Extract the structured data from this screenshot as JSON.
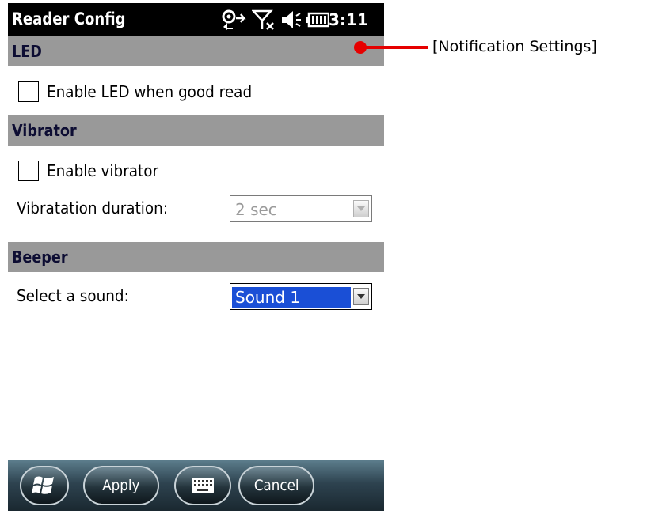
{
  "status_bar": {
    "app_title": "Reader Config",
    "time": "3:11",
    "icons": [
      "sync-icon",
      "no-signal-icon",
      "volume-icon",
      "battery-icon"
    ]
  },
  "sections": {
    "led": {
      "header": "LED",
      "enable_label": "Enable LED when good read",
      "enable_checked": false
    },
    "vibrator": {
      "header": "Vibrator",
      "enable_label": "Enable vibrator",
      "enable_checked": false,
      "duration_label": "Vibratation duration:",
      "duration_value": "2 sec",
      "duration_enabled": false
    },
    "beeper": {
      "header": "Beeper",
      "sound_label": "Select a sound:",
      "sound_value": "Sound 1"
    }
  },
  "menu_bar": {
    "start_icon": "windows-start-icon",
    "apply_label": "Apply",
    "keyboard_icon": "keyboard-icon",
    "cancel_label": "Cancel"
  },
  "annotation": {
    "label": "[Notification Settings]"
  },
  "colors": {
    "section_header_bg": "#999999",
    "section_header_text": "#0d0d33",
    "selection_bg": "#1a4fd6",
    "callout": "#e60000"
  }
}
